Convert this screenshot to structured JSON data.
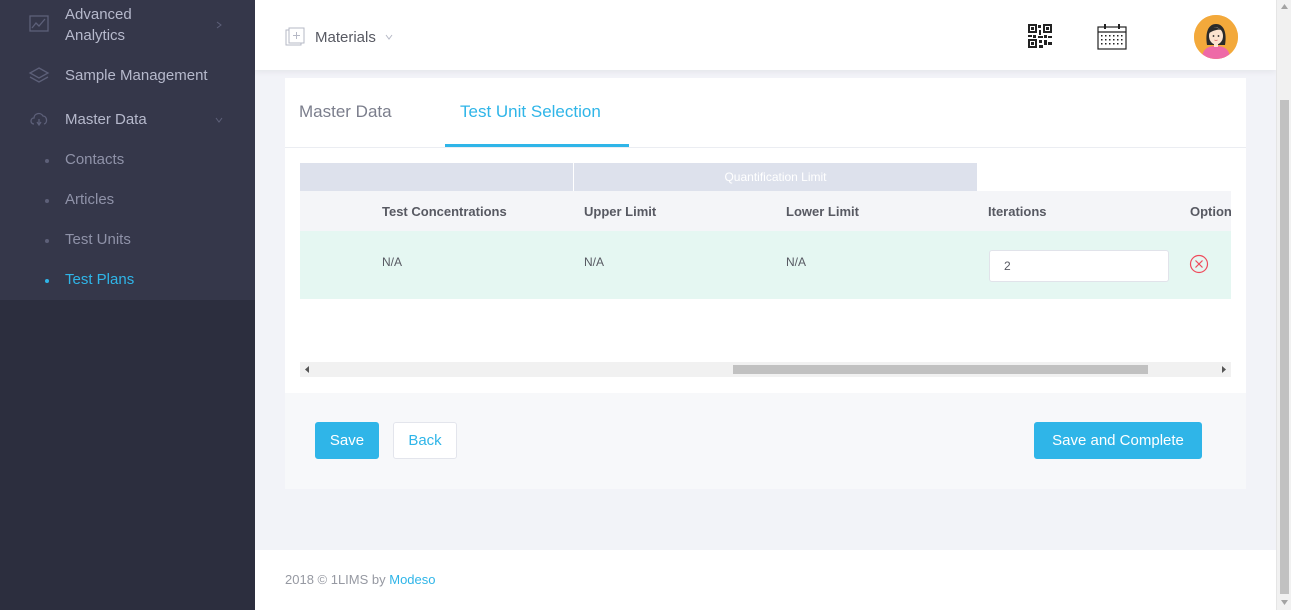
{
  "sidebar": {
    "items": [
      {
        "label_line1": "Advanced",
        "label_line2": "Analytics",
        "icon": "chart-icon"
      },
      {
        "label": "Sample Management",
        "icon": "layers-icon"
      },
      {
        "label": "Master Data",
        "icon": "cloud-icon"
      }
    ],
    "sub_items": [
      "Contacts",
      "Articles",
      "Test Units",
      "Test Plans"
    ],
    "active_sub_item": "Test Plans",
    "accent_color": "#2fb5e8"
  },
  "header": {
    "materials_label": "Materials",
    "icons": [
      "qr-code-icon",
      "calendar-icon"
    ]
  },
  "tabs": [
    {
      "label": "Master Data",
      "active": false
    },
    {
      "label": "Test Unit Selection",
      "active": true
    }
  ],
  "table": {
    "group_header": "Quantification Limit",
    "columns": [
      "Test Concentrations",
      "Upper Limit",
      "Lower Limit",
      "Iterations",
      "Option"
    ],
    "rows": [
      {
        "test_concentrations": "N/A",
        "upper_limit": "N/A",
        "lower_limit": "N/A",
        "iterations": "2"
      }
    ]
  },
  "buttons": {
    "save": "Save",
    "back": "Back",
    "save_complete": "Save and Complete"
  },
  "footer": {
    "copyright": "2018 © 1LIMS by ",
    "company": "Modeso"
  }
}
